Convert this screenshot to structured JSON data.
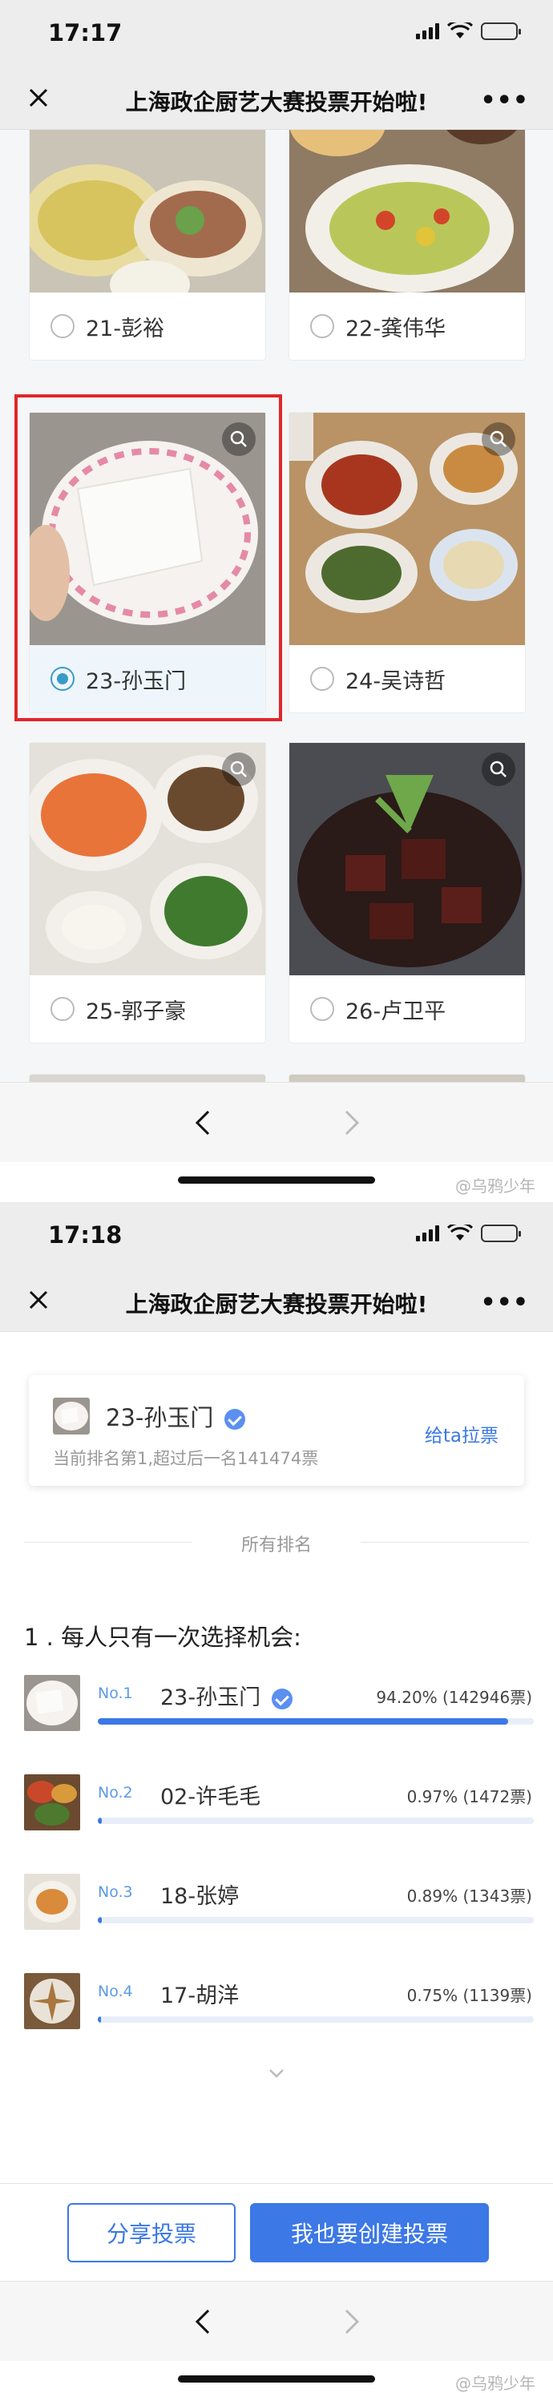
{
  "status_bar_1": {
    "time": "17:17"
  },
  "status_bar_2": {
    "time": "17:18"
  },
  "nav": {
    "title": "上海政企厨艺大赛投票开始啦!",
    "more": "•••"
  },
  "grid_cards": [
    {
      "label": "21-彭裕",
      "selected": false
    },
    {
      "label": "22-龚伟华",
      "selected": false
    },
    {
      "label": "23-孙玉门",
      "selected": true
    },
    {
      "label": "24-吴诗哲",
      "selected": false
    },
    {
      "label": "25-郭子豪",
      "selected": false
    },
    {
      "label": "26-卢卫平",
      "selected": false
    }
  ],
  "watermark": "@乌鸦少年",
  "candidate_card": {
    "name": "23-孙玉门",
    "subtitle": "当前排名第1,超过后一名141474票",
    "action": "给ta拉票"
  },
  "divider_label": "所有排名",
  "question": "1 . 每人只有一次选择机会:",
  "rankings": [
    {
      "rank": "No.1",
      "name": "23-孙玉门",
      "verified": true,
      "value": "94.20% (142946票)",
      "percent": 94.2
    },
    {
      "rank": "No.2",
      "name": "02-许毛毛",
      "verified": false,
      "value": "0.97% (1472票)",
      "percent": 0.97
    },
    {
      "rank": "No.3",
      "name": "18-张婷",
      "verified": false,
      "value": "0.89% (1343票)",
      "percent": 0.89
    },
    {
      "rank": "No.4",
      "name": "17-胡洋",
      "verified": false,
      "value": "0.75% (1139票)",
      "percent": 0.75
    }
  ],
  "buttons": {
    "share": "分享投票",
    "create": "我也要创建投票"
  },
  "colors": {
    "accent": "#3c78e6",
    "selected_frame": "#e0262b",
    "radio_on": "#3a9ac7"
  }
}
